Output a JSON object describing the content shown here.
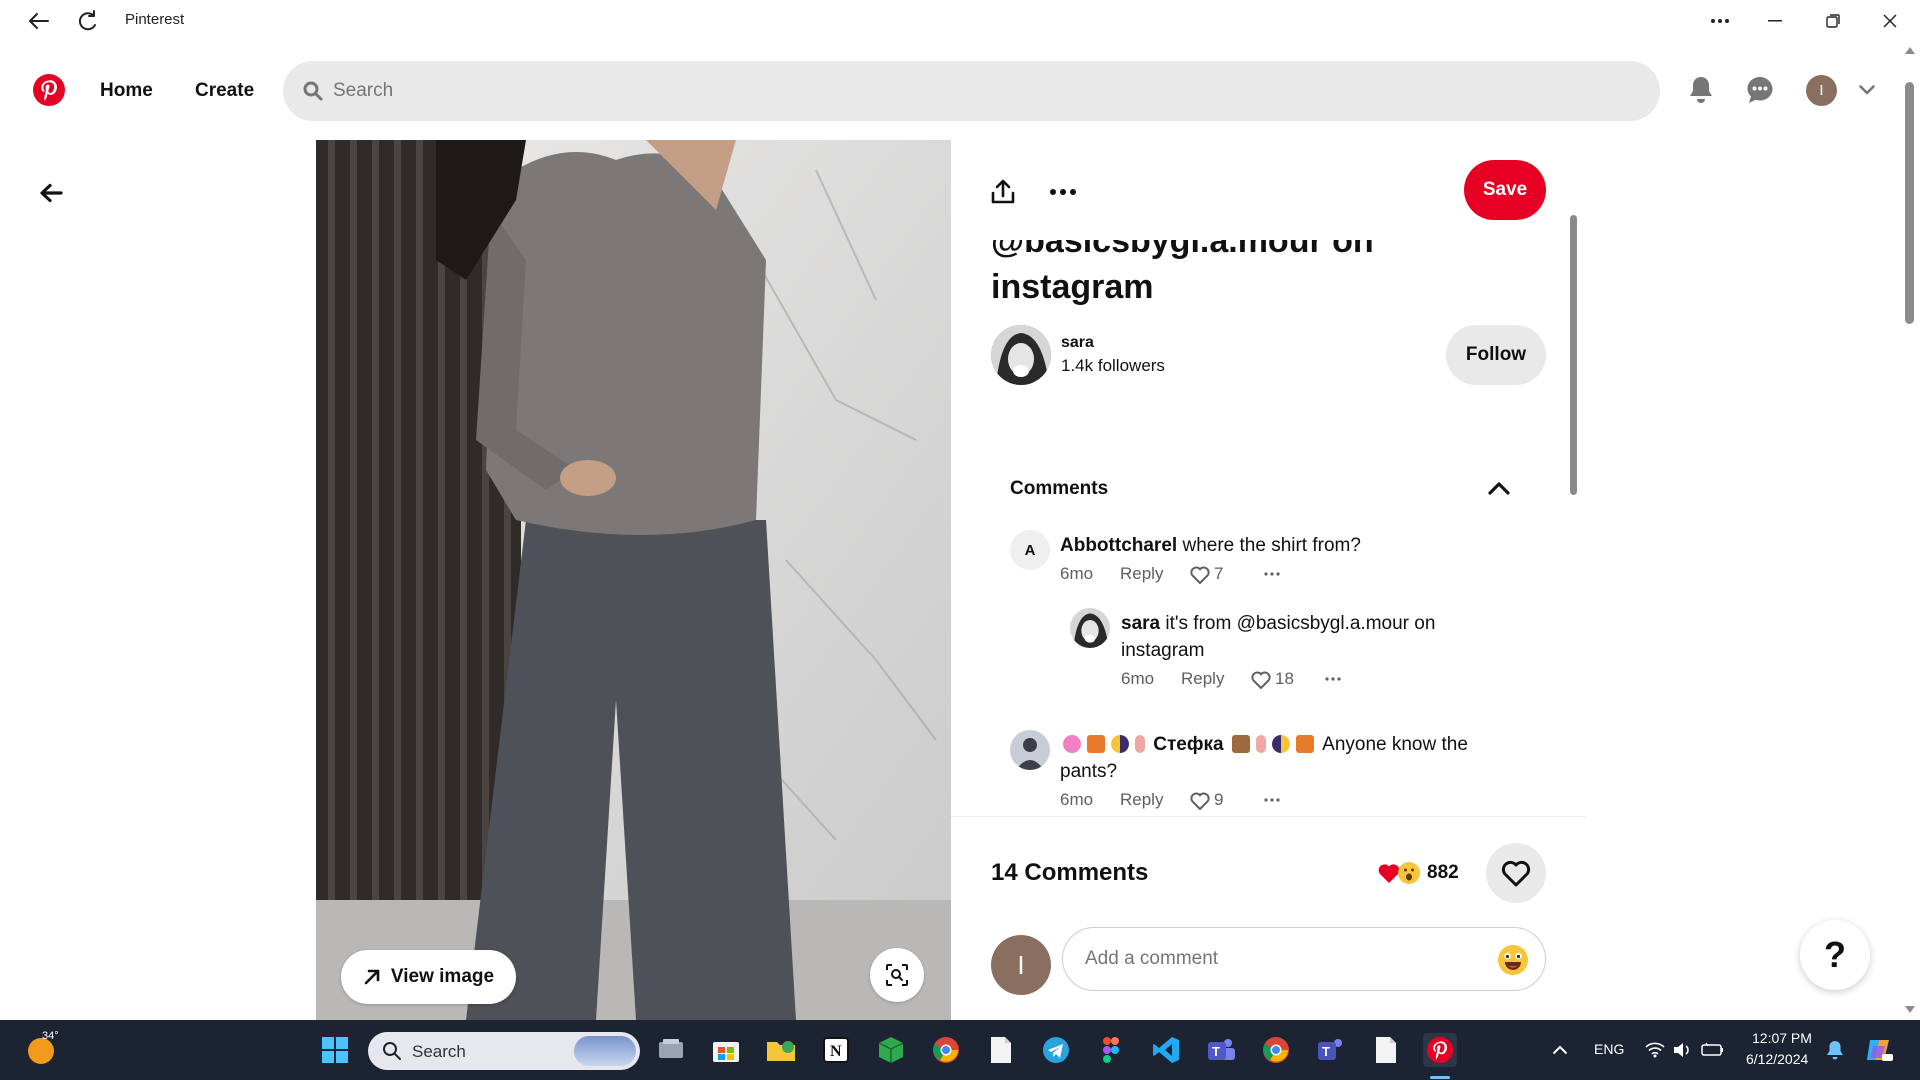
{
  "window": {
    "title": "Pinterest"
  },
  "header": {
    "nav": {
      "home": "Home",
      "create": "Create"
    },
    "search_placeholder": "Search",
    "user_initial": "I"
  },
  "pin": {
    "view_image_label": "View image",
    "save_label": "Save",
    "title_line1": "@basicsbygl.a.mour on",
    "title_line2": "instagram",
    "creator": {
      "name": "sara",
      "followers": "1.4k followers"
    },
    "follow_label": "Follow",
    "comments_heading": "Comments",
    "comments": [
      {
        "avatar_letter": "A",
        "author": "Abbottcharel",
        "text": "where the shirt from?",
        "age": "6mo",
        "reply": "Reply",
        "likes": "7"
      },
      {
        "author": "sara",
        "text_line1": "it's from @basicsbygl.a.mour on",
        "text_line2": "instagram",
        "age": "6mo",
        "reply": "Reply",
        "likes": "18"
      },
      {
        "author": "Стефка",
        "text_line1": "Anyone know the",
        "text_line2": "pants?",
        "age": "6mo",
        "reply": "Reply",
        "likes": "9"
      }
    ],
    "comment_count_label": "14 Comments",
    "reaction_count": "882",
    "add_comment_placeholder": "Add a comment",
    "me_initial": "I"
  },
  "help_label": "?",
  "taskbar": {
    "temperature": "34°",
    "search_label": "Search",
    "language": "ENG",
    "time": "12:07 PM",
    "date": "6/12/2024"
  },
  "colors": {
    "brand_red": "#e60023",
    "taskbar": "#1c2333"
  }
}
